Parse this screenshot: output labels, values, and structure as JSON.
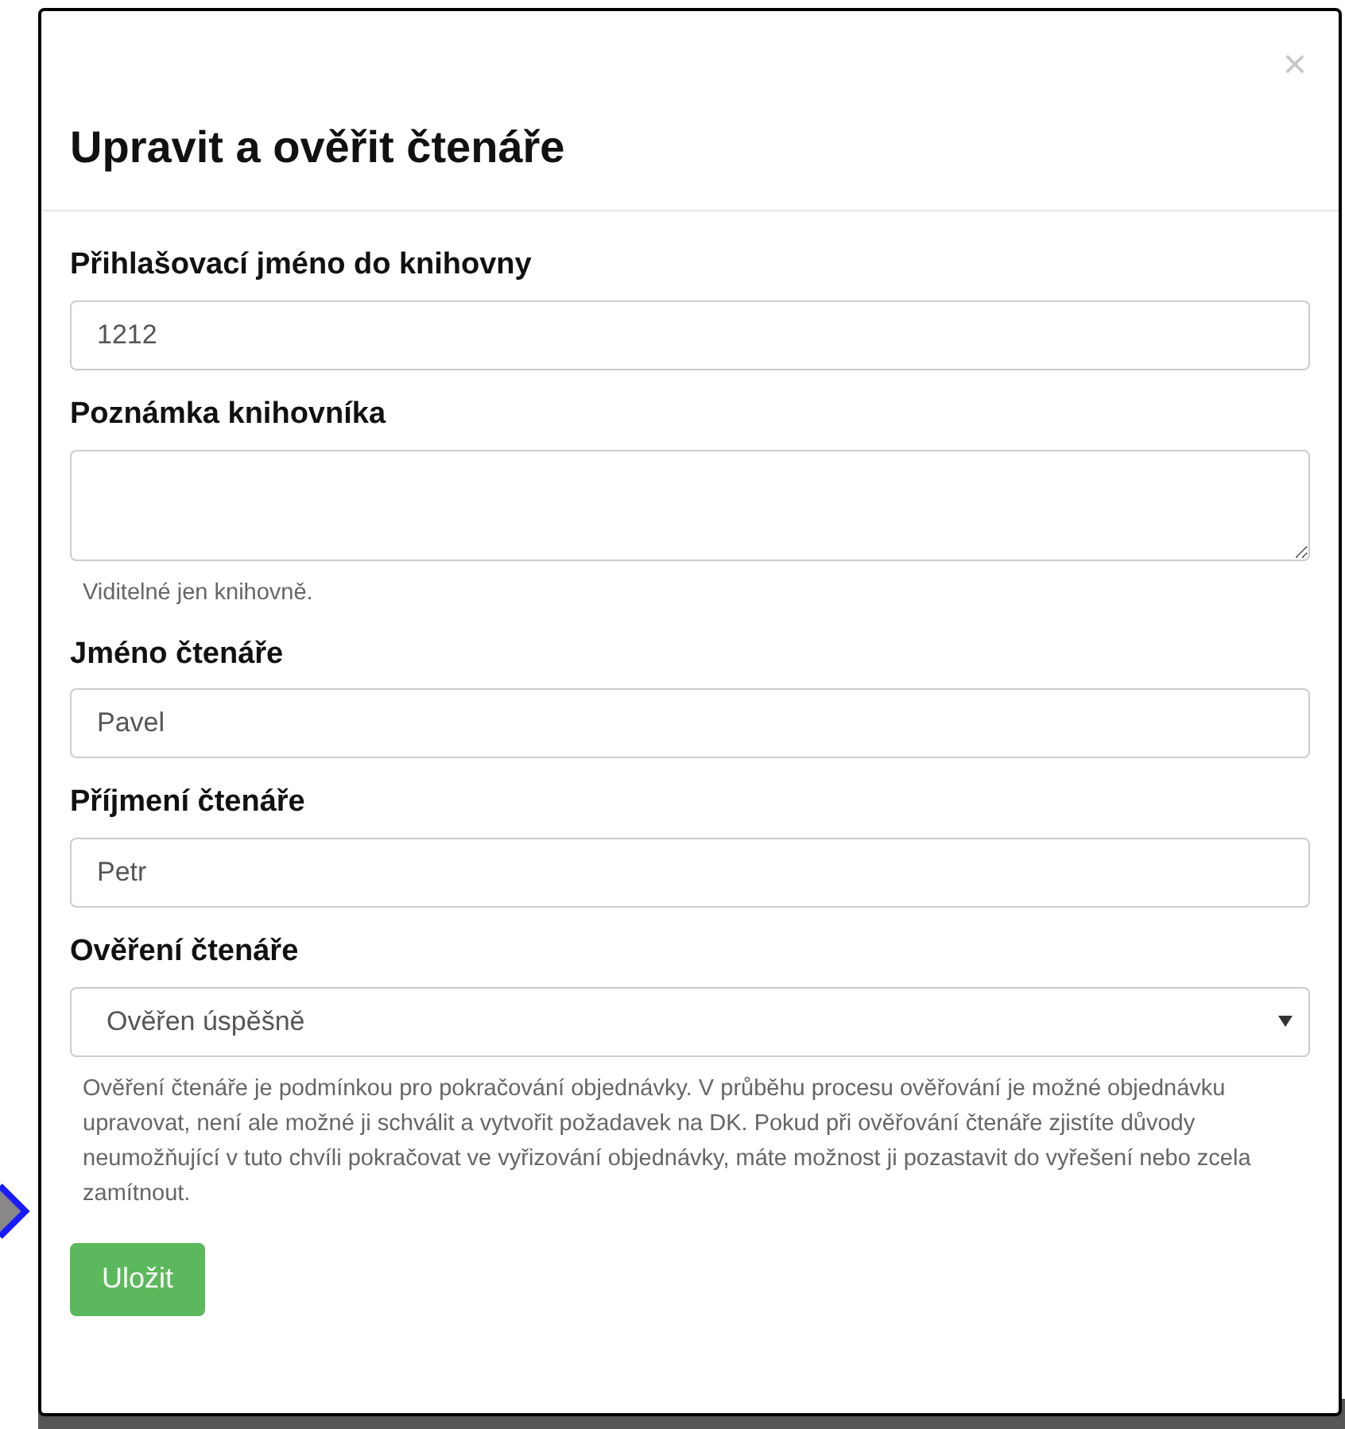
{
  "dialog": {
    "title": "Upravit a ověřit čtenáře",
    "close": "×"
  },
  "fields": [
    {
      "kind": "input",
      "label": "Přihlašovací jméno do knihovny",
      "value": "1212"
    },
    {
      "kind": "textarea",
      "label": "Poznámka knihovníka",
      "help": "Viditelné jen knihovně."
    },
    {
      "kind": "input",
      "label": "Jméno čtenáře",
      "value": "Pavel"
    },
    {
      "kind": "input",
      "label": "Příjmení čtenáře",
      "value": "Petr"
    },
    {
      "kind": "select",
      "label": "Ověření čtenáře",
      "value": "Ověřen úspěšně",
      "help": "Ověření čtenáře je podmínkou pro pokračování objednávky. V průběhu procesu ověřování je možné objednávku upravovat, není ale možné ji schválit a vytvořit požadavek na DK. Pokud při ověřování čtenáře zjistíte důvody neumožňující v tuto chvíli pokračovat ve vyřizování objednávky, máte možnost ji pozastavit do vyřešení nebo zcela zamítnout."
    }
  ],
  "save_button": "Uložit"
}
